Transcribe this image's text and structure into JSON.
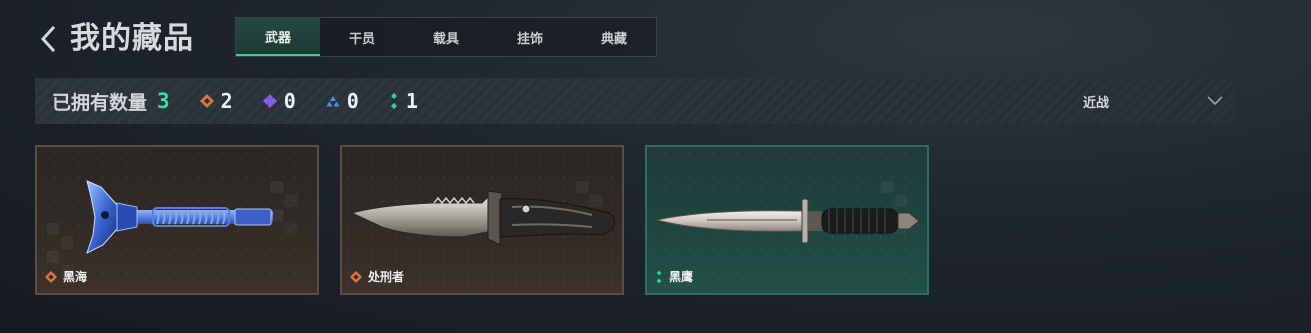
{
  "header": {
    "title": "我的藏品",
    "tabs": [
      {
        "label": "武器",
        "active": true
      },
      {
        "label": "干员",
        "active": false
      },
      {
        "label": "载具",
        "active": false
      },
      {
        "label": "挂饰",
        "active": false
      },
      {
        "label": "典藏",
        "active": false
      }
    ]
  },
  "summary": {
    "owned_label": "已拥有数量",
    "owned_total": "3",
    "rarities": [
      {
        "icon": "orange-diamond-icon",
        "color": "#d9763d",
        "count": "2"
      },
      {
        "icon": "purple-diamond-icon",
        "color": "#8a5cf0",
        "count": "0"
      },
      {
        "icon": "blue-triangle-icon",
        "color": "#4d8fe0",
        "count": "0"
      },
      {
        "icon": "green-dots-icon",
        "color": "#2fd39a",
        "count": "1"
      }
    ],
    "filter": {
      "selected": "近战"
    }
  },
  "cards": [
    {
      "name": "黑海",
      "rarity_icon": "orange-diamond-icon",
      "rarity_color": "#d9763d",
      "weapon": "tomahawk"
    },
    {
      "name": "处刑者",
      "rarity_icon": "orange-diamond-icon",
      "rarity_color": "#d9763d",
      "weapon": "combat-knife"
    },
    {
      "name": "黑鹰",
      "rarity_icon": "green-dots-icon",
      "rarity_color": "#2fd39a",
      "weapon": "dagger"
    }
  ],
  "colors": {
    "accent": "#2fd39a",
    "owned_total": "#2fe0a2"
  }
}
